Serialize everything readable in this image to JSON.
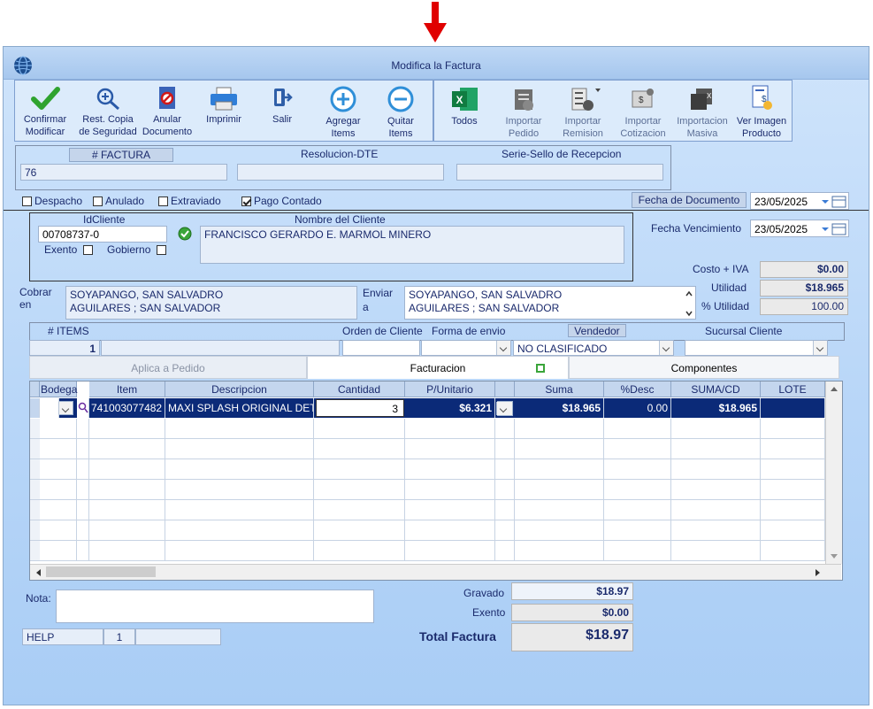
{
  "window": {
    "title": "Modifica la Factura"
  },
  "toolbar": {
    "left": [
      {
        "id": "confirm",
        "label1": "Confirmar",
        "label2": "Modificar"
      },
      {
        "id": "restore",
        "label1": "Rest. Copia",
        "label2": "de Seguridad"
      },
      {
        "id": "annul",
        "label1": "Anular",
        "label2": "Documento"
      },
      {
        "id": "print",
        "label1": "Imprimir",
        "label2": ""
      },
      {
        "id": "exit",
        "label1": "Salir",
        "label2": ""
      },
      {
        "id": "add",
        "label1": "Agregar",
        "label2": "Items"
      },
      {
        "id": "remove",
        "label1": "Quitar",
        "label2": "Items"
      }
    ],
    "right": [
      {
        "id": "todos",
        "label1": "Todos",
        "label2": ""
      },
      {
        "id": "import_order",
        "label1": "Importar",
        "label2": "Pedido"
      },
      {
        "id": "import_remision",
        "label1": "Importar",
        "label2": "Remision"
      },
      {
        "id": "import_quote",
        "label1": "Importar",
        "label2": "Cotizacion"
      },
      {
        "id": "import_mass",
        "label1": "Importacion",
        "label2": "Masiva"
      },
      {
        "id": "view_image",
        "label1": "Ver Imagen",
        "label2": "Producto"
      }
    ]
  },
  "invoice_header": {
    "num_label": "# FACTURA",
    "num_value": "76",
    "resolution_label": "Resolucion-DTE",
    "resolution_value": "",
    "seal_label": "Serie-Sello de Recepcion",
    "seal_value": ""
  },
  "flags": {
    "despacho": {
      "label": "Despacho",
      "checked": false
    },
    "anulado": {
      "label": "Anulado",
      "checked": false
    },
    "extraviado": {
      "label": "Extraviado",
      "checked": false
    },
    "pago_contado": {
      "label": "Pago Contado",
      "checked": true
    }
  },
  "dates": {
    "doc_label": "Fecha de  Documento",
    "doc_value": "23/05/2025",
    "due_label": "Fecha Vencimiento",
    "due_value": "23/05/2025"
  },
  "client": {
    "id_label": "IdCliente",
    "id_value": "00708737-0",
    "name_label": "Nombre del Cliente",
    "name_value": "FRANCISCO GERARDO E. MARMOL MINERO",
    "exento_label": "Exento",
    "gobierno_label": "Gobierno"
  },
  "costs": {
    "costo_label": "Costo + IVA",
    "costo_value": "$0.00",
    "utilidad_label": "Utilidad",
    "utilidad_value": "$18.965",
    "pct_label": "% Utilidad",
    "pct_value": "100.00"
  },
  "address": {
    "cobrar_label1": "Cobrar",
    "cobrar_label2": "en",
    "cobrar_line1": "SOYAPANGO, SAN SALVADRO",
    "cobrar_line2": "AGUILARES ; SAN SALVADOR",
    "enviar_label1": "Enviar",
    "enviar_label2": "a",
    "enviar_line1": "SOYAPANGO, SAN SALVADRO",
    "enviar_line2": "AGUILARES ; SAN SALVADOR"
  },
  "items_bar": {
    "items_label": "# ITEMS",
    "items_value": "1",
    "orden_label": "Orden de Cliente",
    "forma_label": "Forma de envio",
    "vendedor_label": "Vendedor",
    "vendedor_value": "NO CLASIFICADO",
    "sucursal_label": "Sucursal Cliente"
  },
  "tabs": [
    "Aplica a Pedido",
    "Facturacion",
    "Componentes"
  ],
  "grid": {
    "columns": [
      "Bodega",
      "Item",
      "Descripcion",
      "Cantidad",
      "P/Unitario",
      "Suma",
      "%Desc",
      "SUMA/CD",
      "LOTE"
    ],
    "rows": [
      {
        "item": "741003077482",
        "descripcion": "MAXI SPLASH ORIGINAL DET",
        "cantidad": "3",
        "punitario": "$6.321",
        "suma": "$18.965",
        "desc": "0.00",
        "sumacd": "$18.965",
        "lote": ""
      }
    ]
  },
  "footer": {
    "nota_label": "Nota:",
    "help_label": "HELP",
    "help_num": "1",
    "gravado_label": "Gravado",
    "gravado_value": "$18.97",
    "exento_label": "Exento",
    "exento_value": "$0.00",
    "total_label": "Total Factura",
    "total_value": "$18.97"
  },
  "colors": {
    "accent_red": "#e00000",
    "selected_row": "#0b2a78",
    "window_bg": "#b8d6f8"
  }
}
